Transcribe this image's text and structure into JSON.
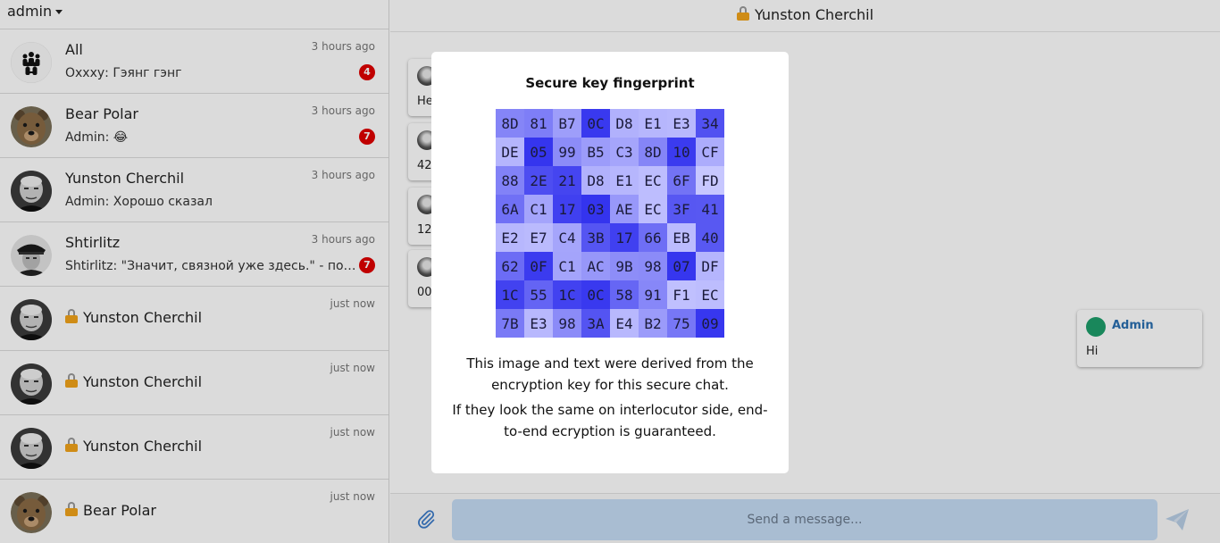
{
  "sidebar": {
    "user_menu": "admin",
    "chats": [
      {
        "name": "All",
        "time": "3 hours ago",
        "preview": "Оххху: Гэянг гэнг",
        "badge": "4",
        "avatar": "group-icon"
      },
      {
        "name": "Bear Polar",
        "time": "3 hours ago",
        "preview": "Admin: 😂",
        "badge": "7",
        "avatar": "bear"
      },
      {
        "name": "Yunston Cherchil",
        "time": "3 hours ago",
        "preview": "Admin: Хорошо сказал",
        "avatar": "portrait"
      },
      {
        "name": "Shtirlitz",
        "time": "3 hours ago",
        "preview": "Shtirlitz: \"Значит, связной уже здесь.\" - подумал Штирлиц.",
        "badge": "7",
        "avatar": "officer"
      },
      {
        "name": "Yunston Cherchil",
        "time": "just now",
        "secure": true,
        "avatar": "portrait"
      },
      {
        "name": "Yunston Cherchil",
        "time": "just now",
        "secure": true,
        "avatar": "portrait"
      },
      {
        "name": "Yunston Cherchil",
        "time": "just now",
        "secure": true,
        "avatar": "portrait"
      },
      {
        "name": "Bear Polar",
        "time": "just now",
        "secure": true,
        "avatar": "bear"
      }
    ]
  },
  "main": {
    "title": "Yunston Cherchil",
    "messages_left": [
      "He",
      "42",
      "12.",
      "000"
    ],
    "message_right": {
      "author": "Admin",
      "text": "Hi"
    },
    "composer": {
      "placeholder": "Send a message..."
    }
  },
  "modal": {
    "title": "Secure key fingerprint",
    "fingerprint": [
      [
        "8D",
        "81",
        "B7",
        "0C",
        "D8",
        "E1",
        "E3",
        "34"
      ],
      [
        "DE",
        "05",
        "99",
        "B5",
        "C3",
        "8D",
        "10",
        "CF"
      ],
      [
        "88",
        "2E",
        "21",
        "D8",
        "E1",
        "EC",
        "6F",
        "FD"
      ],
      [
        "6A",
        "C1",
        "17",
        "03",
        "AE",
        "EC",
        "3F",
        "41"
      ],
      [
        "E2",
        "E7",
        "C4",
        "3B",
        "17",
        "66",
        "EB",
        "40"
      ],
      [
        "62",
        "0F",
        "C1",
        "AC",
        "9B",
        "98",
        "07",
        "DF"
      ],
      [
        "1C",
        "55",
        "1C",
        "0C",
        "58",
        "91",
        "F1",
        "EC"
      ],
      [
        "7B",
        "E3",
        "98",
        "3A",
        "E4",
        "B2",
        "75",
        "09"
      ]
    ],
    "text1": "This image and text were derived from the encryption key for this secure chat.",
    "text2": "If they look the same on interlocutor side, end-to-end ecryption is guaranteed."
  },
  "colors": {
    "badge": "#e00000",
    "lock": "#f2a31a",
    "input_bg": "#c5dcf5",
    "author": "#2a6fb0",
    "fp_light": "#c8c8ff",
    "fp_dark": "#3232ee"
  }
}
